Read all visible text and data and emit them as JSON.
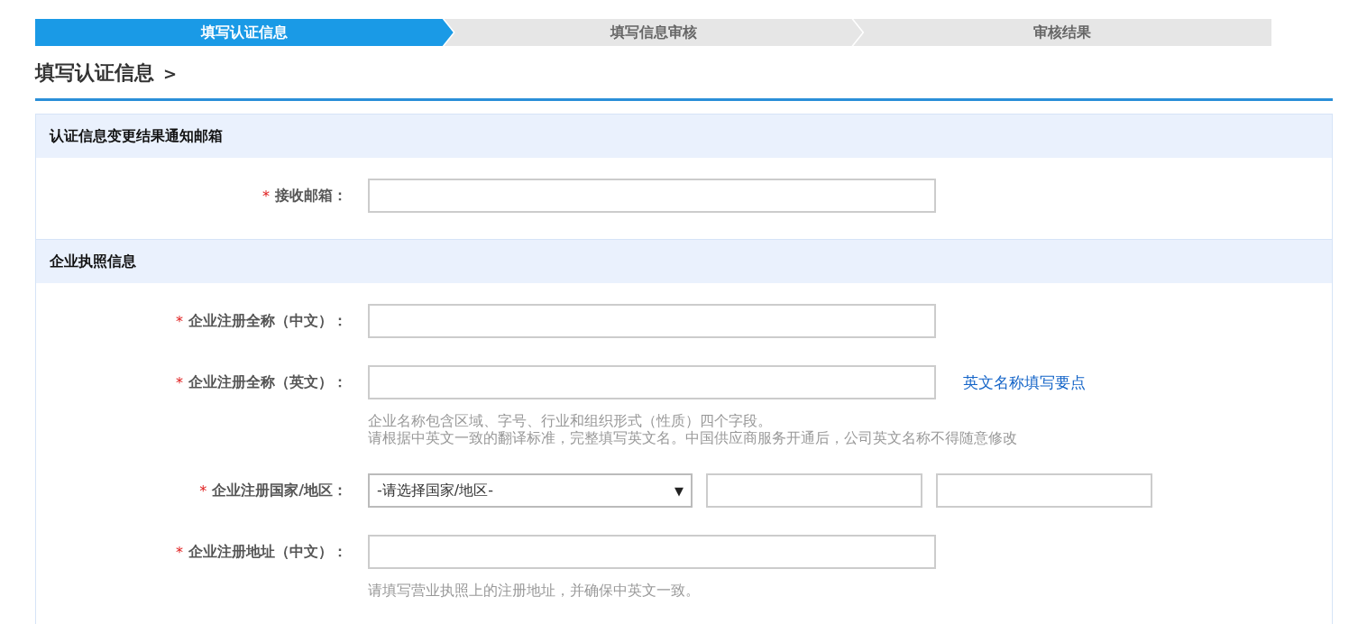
{
  "steps": [
    {
      "label": "填写认证信息",
      "selected": true
    },
    {
      "label": "填写信息审核",
      "selected": false
    },
    {
      "label": "审核结果",
      "selected": false
    }
  ],
  "page_title": "填写认证信息",
  "page_title_arrow": ">",
  "sections": [
    {
      "title": "认证信息变更结果通知邮箱",
      "fields": [
        {
          "kind": "text",
          "label": "接收邮箱：",
          "required_mark": "*"
        }
      ]
    },
    {
      "title": "企业执照信息",
      "fields": [
        {
          "kind": "text",
          "label": "企业注册全称（中文）：",
          "required_mark": "*"
        },
        {
          "kind": "text",
          "label": "企业注册全称（英文）：",
          "required_mark": "*",
          "link": "英文名称填写要点",
          "hints": [
            "企业名称包含区域、字号、行业和组织形式（性质）四个字段。",
            "请根据中英文一致的翻译标准，完整填写英文名。中国供应商服务开通后，公司英文名称不得随意修改"
          ]
        },
        {
          "kind": "select",
          "label": "企业注册国家/地区：",
          "required_mark": "*",
          "select_value": "-请选择国家/地区-",
          "select_arrow": "▼"
        },
        {
          "kind": "text",
          "label": "企业注册地址（中文）：",
          "required_mark": "*",
          "hints": [
            "请填写营业执照上的注册地址，并确保中英文一致。"
          ]
        }
      ]
    }
  ]
}
